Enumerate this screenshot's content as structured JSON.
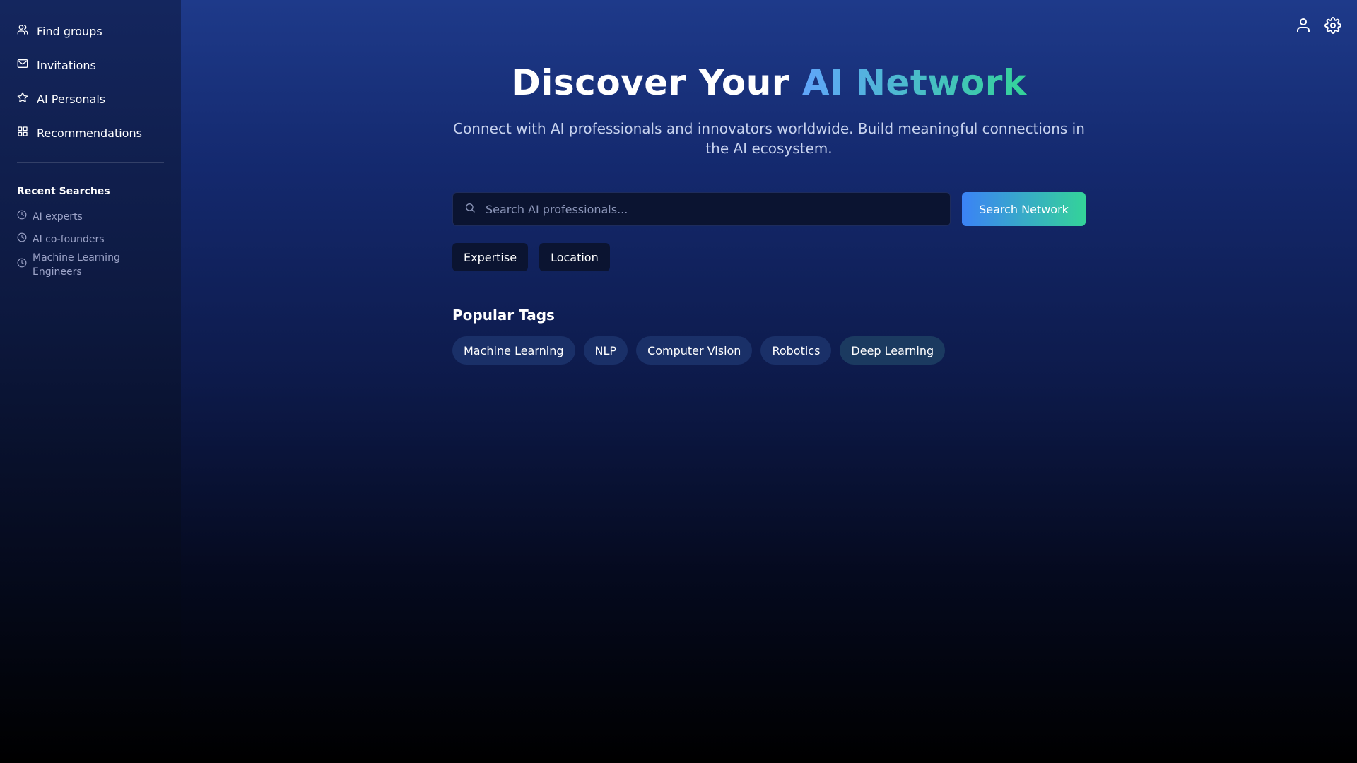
{
  "sidebar": {
    "nav": [
      {
        "label": "Find groups",
        "icon": "users-icon"
      },
      {
        "label": "Invitations",
        "icon": "mail-icon"
      },
      {
        "label": "AI Personals",
        "icon": "star-icon"
      },
      {
        "label": "Recommendations",
        "icon": "grid-icon"
      }
    ],
    "recent_title": "Recent Searches",
    "recent": [
      {
        "label": "AI experts",
        "icon": "clock-icon"
      },
      {
        "label": "AI co-founders",
        "icon": "clock-icon"
      },
      {
        "label": "Machine Learning Engineers",
        "icon": "clock-icon"
      }
    ]
  },
  "header": {
    "icons": [
      "user-icon",
      "settings-icon"
    ]
  },
  "hero": {
    "title_plain": "Discover Your ",
    "title_accent": "AI Network",
    "subtitle": "Connect with AI professionals and innovators worldwide. Build meaningful connections in the AI ecosystem."
  },
  "search": {
    "placeholder": "Search AI professionals...",
    "value": "",
    "button_label": "Search Network"
  },
  "filters": [
    "Expertise",
    "Location"
  ],
  "popular_tags": {
    "title": "Popular Tags",
    "tags": [
      "Machine Learning",
      "NLP",
      "Computer Vision",
      "Robotics",
      "Deep Learning"
    ]
  },
  "colors": {
    "accent_start": "#60a5fa",
    "accent_end": "#34d399",
    "background_top": "#1e3a8a",
    "background_bottom": "#000000"
  }
}
